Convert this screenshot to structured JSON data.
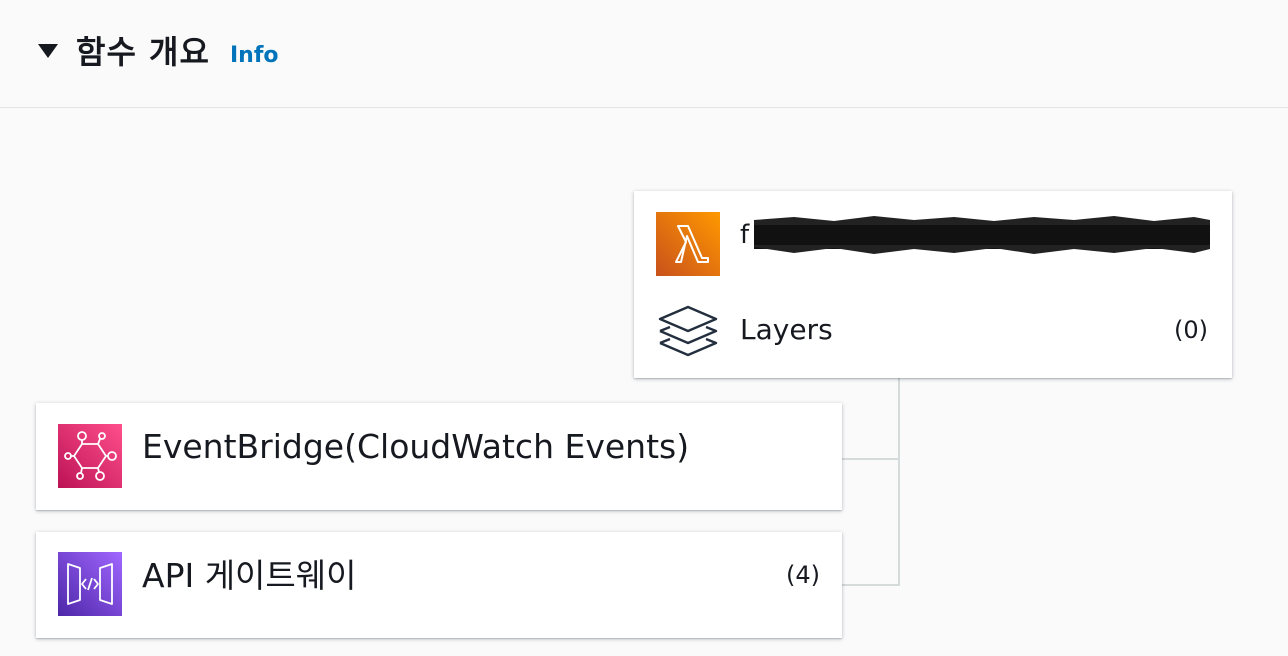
{
  "header": {
    "title": "함수 개요",
    "info_link": "Info"
  },
  "function": {
    "name_visible_prefix": "f",
    "icon": "lambda-icon",
    "icon_color": "#ed7100",
    "layers": {
      "label": "Layers",
      "count": "(0)",
      "icon": "layers-icon"
    }
  },
  "triggers": [
    {
      "label": "EventBridge(CloudWatch Events)",
      "count": "",
      "icon": "eventbridge-icon",
      "icon_color": "#e7157b"
    },
    {
      "label": "API 게이트웨이",
      "count": "(4)",
      "icon": "api-gateway-icon",
      "icon_color": "#8c4fff"
    }
  ],
  "colors": {
    "background": "#fafafa",
    "link": "#0073bb",
    "text": "#16191f",
    "connector": "#d5dbdb"
  }
}
